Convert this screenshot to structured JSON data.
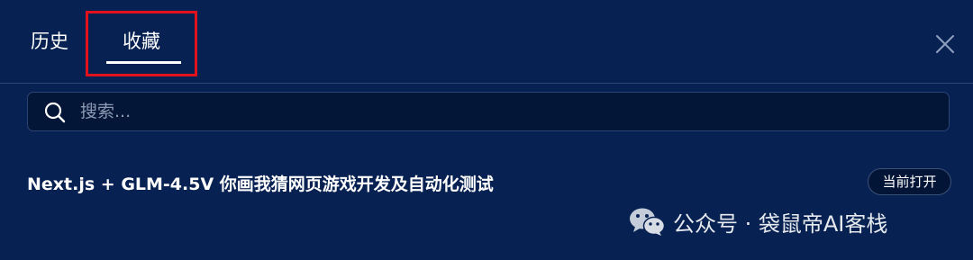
{
  "tabs": [
    {
      "label": "历史",
      "active": false
    },
    {
      "label": "收藏",
      "active": true
    }
  ],
  "search": {
    "placeholder": "搜索...",
    "value": ""
  },
  "items": [
    {
      "title": "Next.js + GLM-4.5V 你画我猜网页游戏开发及自动化测试",
      "badge": "当前打开"
    }
  ],
  "watermark": {
    "text": "公众号 · 袋鼠帝AI客栈"
  },
  "icons": {
    "close": "close-icon",
    "search": "search-icon",
    "watermark": "wechat-icon"
  },
  "colors": {
    "background": "#062152",
    "highlight": "#e2121d",
    "text": "#ffffff",
    "placeholder": "#8d9ab3"
  }
}
